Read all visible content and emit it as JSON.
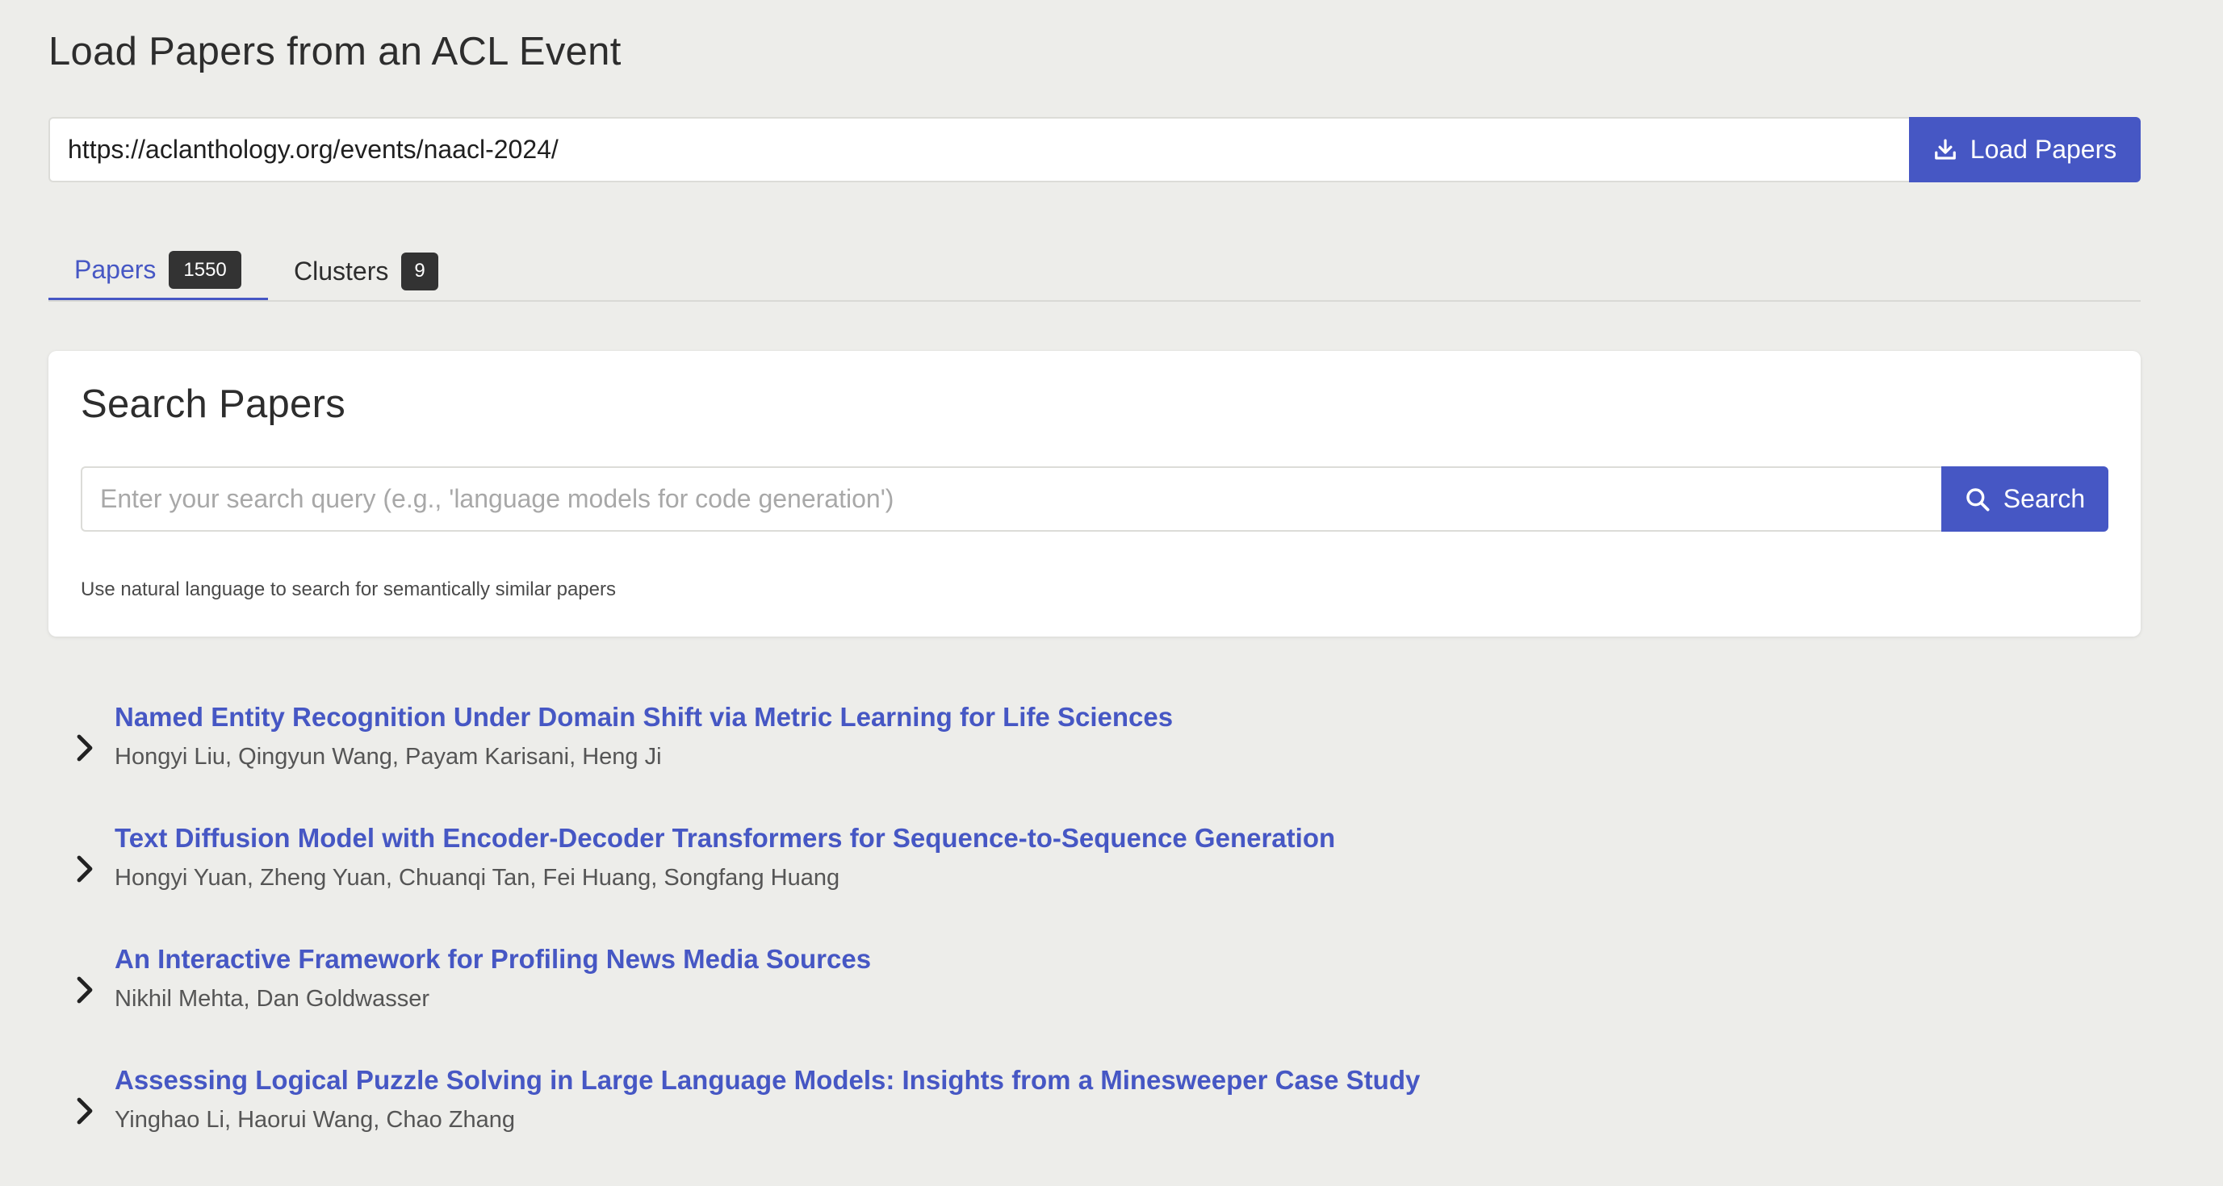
{
  "load_section": {
    "title": "Load Papers from an ACL Event",
    "url_value": "https://aclanthology.org/events/naacl-2024/",
    "load_button_label": "Load Papers"
  },
  "tabs": [
    {
      "label": "Papers",
      "count": "1550",
      "active": true
    },
    {
      "label": "Clusters",
      "count": "9",
      "active": false
    }
  ],
  "search": {
    "title": "Search Papers",
    "placeholder": "Enter your search query (e.g., 'language models for code generation')",
    "button_label": "Search",
    "hint": "Use natural language to search for semantically similar papers"
  },
  "papers": [
    {
      "title": "Named Entity Recognition Under Domain Shift via Metric Learning for Life Sciences",
      "authors": "Hongyi Liu, Qingyun Wang, Payam Karisani, Heng Ji"
    },
    {
      "title": "Text Diffusion Model with Encoder-Decoder Transformers for Sequence-to-Sequence Generation",
      "authors": "Hongyi Yuan, Zheng Yuan, Chuanqi Tan, Fei Huang, Songfang Huang"
    },
    {
      "title": "An Interactive Framework for Profiling News Media Sources",
      "authors": "Nikhil Mehta, Dan Goldwasser"
    },
    {
      "title": "Assessing Logical Puzzle Solving in Large Language Models: Insights from a Minesweeper Case Study",
      "authors": "Yinghao Li, Haorui Wang, Chao Zhang"
    }
  ],
  "colors": {
    "background": "#ededea",
    "accent": "#4657c4",
    "badge": "#333333",
    "card": "#ffffff"
  },
  "icons": {
    "load_button": "download-icon",
    "search_button": "search-icon",
    "paper_expand": "chevron-right-icon"
  }
}
